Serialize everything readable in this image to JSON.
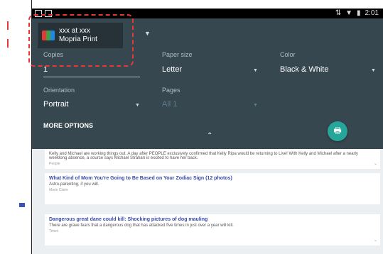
{
  "status_bar": {
    "time": "2:01"
  },
  "printer": {
    "name": "xxx at xxx",
    "service": "Mopria Print"
  },
  "fields": {
    "copies": {
      "label": "Copies",
      "value": "1"
    },
    "paper_size": {
      "label": "Paper size",
      "value": "Letter"
    },
    "color": {
      "label": "Color",
      "value": "Black & White"
    },
    "orientation": {
      "label": "Orientation",
      "value": "Portrait"
    },
    "pages": {
      "label": "Pages",
      "value": "All 1"
    }
  },
  "more_options_label": "MORE OPTIONS",
  "collapse_glyph": "⌃",
  "print_icon": "print-icon",
  "articles": [
    {
      "title": "",
      "desc": "Kelly and Michael are working things out. A day after PEOPLE exclusively confirmed that Kelly Ripa would be returning to Live! With Kelly and Michael after a nearly weeklong absence, a source says Michael Strahan is excited to have her back.",
      "source": "People"
    },
    {
      "title": "What Kind of Mom You're Going to Be Based on Your Zodiac Sign (12 photos)",
      "desc": "Astro-parenting, if you will.",
      "source": "Marie Claire"
    },
    {
      "title": "Dangerous great dane could kill: Shocking pictures of dog mauling",
      "desc": "There are grave fears that a dangerous dog that has attacked five times in just over a year will kill.",
      "source": "Times"
    }
  ],
  "colors": {
    "panel": "#37474f",
    "fab": "#26a69a",
    "highlight": "#e53935"
  }
}
